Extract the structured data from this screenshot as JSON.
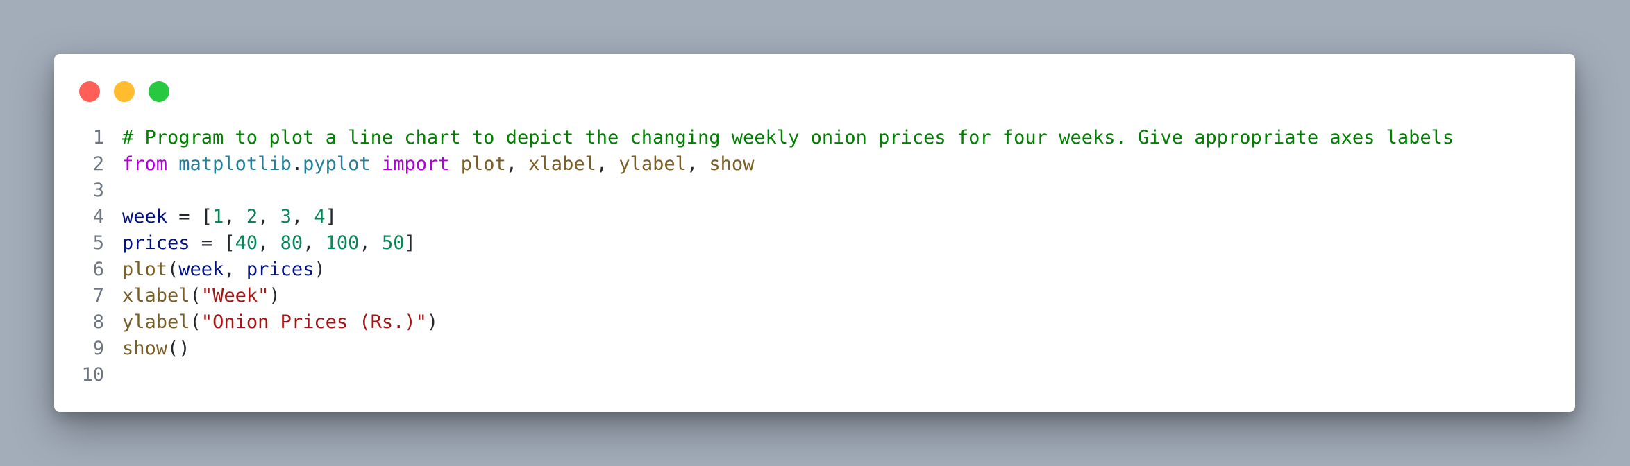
{
  "window": {
    "controls": [
      "close",
      "minimize",
      "maximize"
    ]
  },
  "colors": {
    "background": "#a3adba",
    "comment": "#008000",
    "keyword": "#af00db",
    "module": "#267f99",
    "function": "#795e26",
    "variable": "#001080",
    "number": "#098658",
    "string": "#a31515",
    "line_number": "#6e7781"
  },
  "code": {
    "lines": [
      {
        "number": "1",
        "tokens": [
          {
            "type": "comment",
            "text": "# Program to plot a line chart to depict the changing weekly onion prices for four weeks. Give appropriate axes labels"
          }
        ]
      },
      {
        "number": "2",
        "tokens": [
          {
            "type": "kw",
            "text": "from"
          },
          {
            "type": "punc",
            "text": " "
          },
          {
            "type": "mod",
            "text": "matplotlib"
          },
          {
            "type": "punc",
            "text": "."
          },
          {
            "type": "mod",
            "text": "pyplot"
          },
          {
            "type": "punc",
            "text": " "
          },
          {
            "type": "kw",
            "text": "import"
          },
          {
            "type": "punc",
            "text": " "
          },
          {
            "type": "fn",
            "text": "plot"
          },
          {
            "type": "punc",
            "text": ", "
          },
          {
            "type": "fn",
            "text": "xlabel"
          },
          {
            "type": "punc",
            "text": ", "
          },
          {
            "type": "fn",
            "text": "ylabel"
          },
          {
            "type": "punc",
            "text": ", "
          },
          {
            "type": "fn",
            "text": "show"
          }
        ]
      },
      {
        "number": "3",
        "tokens": []
      },
      {
        "number": "4",
        "tokens": [
          {
            "type": "var",
            "text": "week"
          },
          {
            "type": "punc",
            "text": " = ["
          },
          {
            "type": "num",
            "text": "1"
          },
          {
            "type": "punc",
            "text": ", "
          },
          {
            "type": "num",
            "text": "2"
          },
          {
            "type": "punc",
            "text": ", "
          },
          {
            "type": "num",
            "text": "3"
          },
          {
            "type": "punc",
            "text": ", "
          },
          {
            "type": "num",
            "text": "4"
          },
          {
            "type": "punc",
            "text": "]"
          }
        ]
      },
      {
        "number": "5",
        "tokens": [
          {
            "type": "var",
            "text": "prices"
          },
          {
            "type": "punc",
            "text": " = ["
          },
          {
            "type": "num",
            "text": "40"
          },
          {
            "type": "punc",
            "text": ", "
          },
          {
            "type": "num",
            "text": "80"
          },
          {
            "type": "punc",
            "text": ", "
          },
          {
            "type": "num",
            "text": "100"
          },
          {
            "type": "punc",
            "text": ", "
          },
          {
            "type": "num",
            "text": "50"
          },
          {
            "type": "punc",
            "text": "]"
          }
        ]
      },
      {
        "number": "6",
        "tokens": [
          {
            "type": "fn",
            "text": "plot"
          },
          {
            "type": "punc",
            "text": "("
          },
          {
            "type": "var",
            "text": "week"
          },
          {
            "type": "punc",
            "text": ", "
          },
          {
            "type": "var",
            "text": "prices"
          },
          {
            "type": "punc",
            "text": ")"
          }
        ]
      },
      {
        "number": "7",
        "tokens": [
          {
            "type": "fn",
            "text": "xlabel"
          },
          {
            "type": "punc",
            "text": "("
          },
          {
            "type": "str",
            "text": "\"Week\""
          },
          {
            "type": "punc",
            "text": ")"
          }
        ]
      },
      {
        "number": "8",
        "tokens": [
          {
            "type": "fn",
            "text": "ylabel"
          },
          {
            "type": "punc",
            "text": "("
          },
          {
            "type": "str",
            "text": "\"Onion Prices (Rs.)\""
          },
          {
            "type": "punc",
            "text": ")"
          }
        ]
      },
      {
        "number": "9",
        "tokens": [
          {
            "type": "fn",
            "text": "show"
          },
          {
            "type": "punc",
            "text": "()"
          }
        ]
      },
      {
        "number": "10",
        "tokens": []
      }
    ]
  }
}
